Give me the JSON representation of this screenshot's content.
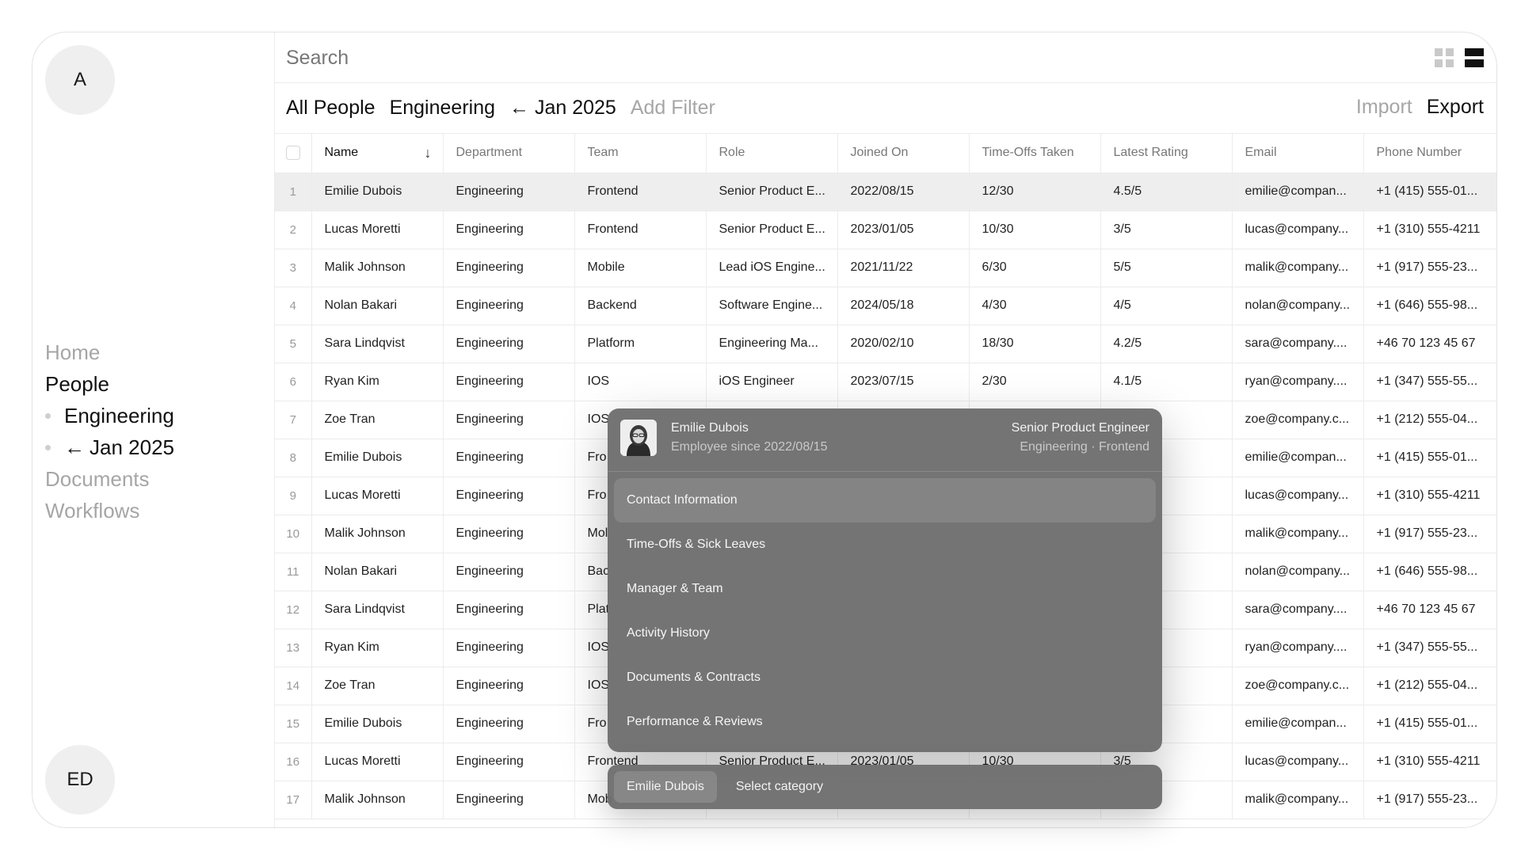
{
  "sidebar": {
    "avatar_top": "A",
    "avatar_bottom": "ED",
    "nav": [
      {
        "label": "Home",
        "icon": ""
      },
      {
        "label": "People",
        "icon": ""
      },
      {
        "label": "Engineering",
        "icon": ""
      },
      {
        "label": "Jan 2025",
        "icon": "←"
      },
      {
        "label": "Documents",
        "icon": ""
      },
      {
        "label": "Workflows",
        "icon": ""
      }
    ]
  },
  "search": {
    "placeholder": "Search"
  },
  "filters": {
    "items": [
      "All People",
      "Engineering",
      "← Jan 2025"
    ],
    "add_filter": "Add Filter",
    "import": "Import",
    "export": "Export"
  },
  "table": {
    "sort_icon": "↓",
    "columns": [
      "Name",
      "Department",
      "Team",
      "Role",
      "Joined On",
      "Time-Offs Taken",
      "Latest Rating",
      "Email",
      "Phone Number"
    ],
    "rows": [
      [
        "1",
        "Emilie Dubois",
        "Engineering",
        "Frontend",
        "Senior Product E...",
        "2022/08/15",
        "12/30",
        "4.5/5",
        "emilie@compan...",
        "+1 (415) 555-01..."
      ],
      [
        "2",
        "Lucas Moretti",
        "Engineering",
        "Frontend",
        "Senior Product E...",
        "2023/01/05",
        "10/30",
        "3/5",
        "lucas@company...",
        "+1 (310) 555-4211"
      ],
      [
        "3",
        "Malik Johnson",
        "Engineering",
        "Mobile",
        "Lead iOS Engine...",
        "2021/11/22",
        "6/30",
        "5/5",
        "malik@company...",
        "+1 (917) 555-23..."
      ],
      [
        "4",
        "Nolan Bakari",
        "Engineering",
        "Backend",
        "Software Engine...",
        "2024/05/18",
        "4/30",
        "4/5",
        "nolan@company...",
        "+1 (646) 555-98..."
      ],
      [
        "5",
        "Sara Lindqvist",
        "Engineering",
        "Platform",
        "Engineering Ma...",
        "2020/02/10",
        "18/30",
        "4.2/5",
        "sara@company....",
        "+46 70 123 45 67"
      ],
      [
        "6",
        "Ryan Kim",
        "Engineering",
        "IOS",
        "iOS Engineer",
        "2023/07/15",
        "2/30",
        "4.1/5",
        "ryan@company....",
        "+1 (347) 555-55..."
      ],
      [
        "7",
        "Zoe Tran",
        "Engineering",
        "IOS",
        "",
        "",
        "",
        "",
        "zoe@company.c...",
        "+1 (212) 555-04..."
      ],
      [
        "8",
        "Emilie Dubois",
        "Engineering",
        "Fro",
        "",
        "",
        "",
        "",
        "emilie@compan...",
        "+1 (415) 555-01..."
      ],
      [
        "9",
        "Lucas Moretti",
        "Engineering",
        "Fro",
        "",
        "",
        "",
        "",
        "lucas@company...",
        "+1 (310) 555-4211"
      ],
      [
        "10",
        "Malik Johnson",
        "Engineering",
        "Mol",
        "",
        "",
        "",
        "",
        "malik@company...",
        "+1 (917) 555-23..."
      ],
      [
        "11",
        "Nolan Bakari",
        "Engineering",
        "Bac",
        "",
        "",
        "",
        "",
        "nolan@company...",
        "+1 (646) 555-98..."
      ],
      [
        "12",
        "Sara Lindqvist",
        "Engineering",
        "Plat",
        "",
        "",
        "",
        "",
        "sara@company....",
        "+46 70 123 45 67"
      ],
      [
        "13",
        "Ryan Kim",
        "Engineering",
        "IOS",
        "",
        "",
        "",
        "",
        "ryan@company....",
        "+1 (347) 555-55..."
      ],
      [
        "14",
        "Zoe Tran",
        "Engineering",
        "IOS",
        "",
        "",
        "",
        "",
        "zoe@company.c...",
        "+1 (212) 555-04..."
      ],
      [
        "15",
        "Emilie Dubois",
        "Engineering",
        "Fro",
        "",
        "",
        "",
        "",
        "emilie@compan...",
        "+1 (415) 555-01..."
      ],
      [
        "16",
        "Lucas Moretti",
        "Engineering",
        "Frontend",
        "Senior Product E...",
        "2023/01/05",
        "10/30",
        "3/5",
        "lucas@company...",
        "+1 (310) 555-4211"
      ],
      [
        "17",
        "Malik Johnson",
        "Engineering",
        "Mob",
        "",
        "",
        "",
        "",
        "malik@company...",
        "+1 (917) 555-23..."
      ]
    ]
  },
  "popover": {
    "name": "Emilie Dubois",
    "since": "Employee since 2022/08/15",
    "role": "Senior Product Engineer",
    "team": "Engineering · Frontend",
    "menu": [
      "Contact Information",
      "Time-Offs & Sick Leaves",
      "Manager & Team",
      "Activity History",
      "Documents & Contracts",
      "Performance & Reviews"
    ]
  },
  "command_bar": {
    "chip": "Emilie Dubois",
    "prompt": "Select category"
  }
}
